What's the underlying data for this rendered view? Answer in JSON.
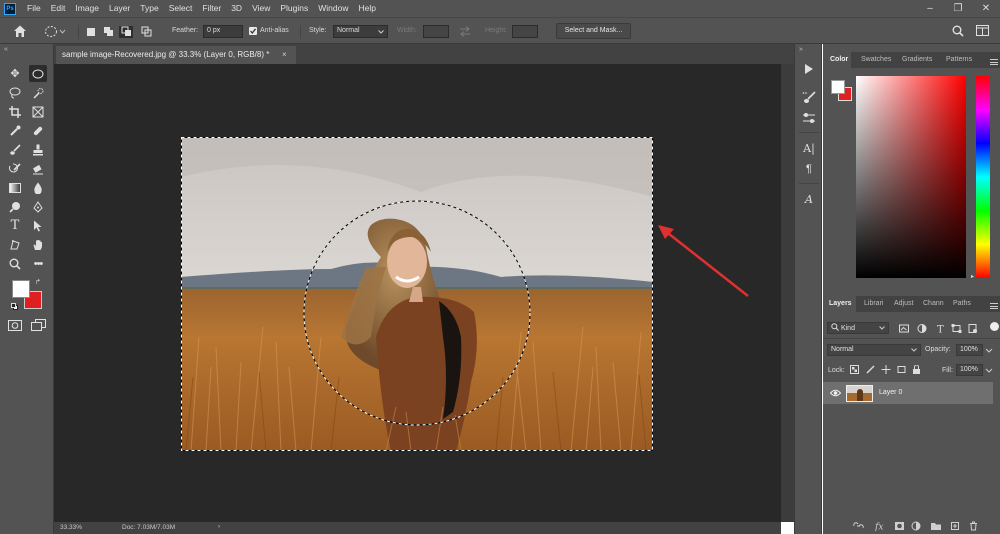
{
  "menubar": {
    "logo": "Ps",
    "items": [
      "File",
      "Edit",
      "Image",
      "Layer",
      "Type",
      "Select",
      "Filter",
      "3D",
      "View",
      "Plugins",
      "Window",
      "Help"
    ],
    "minimize": "–",
    "restore": "❐",
    "close": "✕"
  },
  "options": {
    "feather_label": "Feather:",
    "feather_value": "0 px",
    "antialias_label": "Anti-alias",
    "style_label": "Style:",
    "style_value": "Normal",
    "width_label": "Width:",
    "height_label": "Height:",
    "select_mask_label": "Select and Mask..."
  },
  "document": {
    "tab_title": "sample image-Recovered.jpg @ 33.3% (Layer 0, RGB/8) *",
    "close": "×",
    "zoom": "33.33%",
    "doc_size": "Doc: 7.03M/7.03M"
  },
  "color_panel": {
    "tabs": [
      "Color",
      "Swatches",
      "Gradients",
      "Patterns"
    ],
    "foreground": "#ffffff",
    "background": "#e02020"
  },
  "layers_panel": {
    "tabs": [
      "Layers",
      "Librari",
      "Adjust",
      "Chann",
      "Paths"
    ],
    "filter_kind": "Kind",
    "blend_mode": "Normal",
    "opacity_label": "Opacity:",
    "opacity_value": "100%",
    "lock_label": "Lock:",
    "fill_label": "Fill:",
    "fill_value": "100%",
    "layers": [
      {
        "name": "Layer 0"
      }
    ]
  },
  "colors": {
    "ui_bg": "#535353",
    "canvas_bg": "#282828",
    "annotation_arrow": "#e03030"
  }
}
